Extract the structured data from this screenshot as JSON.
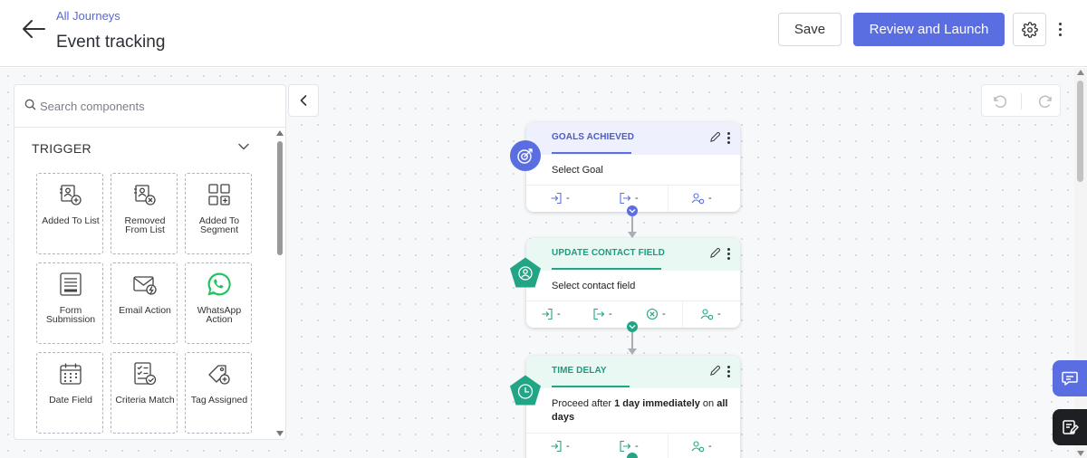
{
  "header": {
    "breadcrumb": "All Journeys",
    "title": "Event tracking",
    "save_label": "Save",
    "launch_label": "Review and Launch"
  },
  "panel": {
    "search_placeholder": "Search components",
    "section_title": "TRIGGER",
    "components": [
      {
        "label": "Added To List",
        "icon": "user-list-add-icon"
      },
      {
        "label": "Removed From List",
        "icon": "user-list-remove-icon"
      },
      {
        "label": "Added To Segment",
        "icon": "segment-add-icon"
      },
      {
        "label": "Form Submission",
        "icon": "form-icon"
      },
      {
        "label": "Email Action",
        "icon": "email-action-icon"
      },
      {
        "label": "WhatsApp Action",
        "icon": "whatsapp-icon"
      },
      {
        "label": "Date Field",
        "icon": "calendar-icon"
      },
      {
        "label": "Criteria Match",
        "icon": "checklist-icon"
      },
      {
        "label": "Tag Assigned",
        "icon": "tag-add-icon"
      }
    ]
  },
  "nodes": [
    {
      "title": "GOALS ACHIEVED",
      "body": "Select Goal",
      "footer": [
        "-",
        "-",
        "-"
      ],
      "color": "#5b6ee1"
    },
    {
      "title": "UPDATE CONTACT FIELD",
      "body": "Select contact field",
      "footer": [
        "-",
        "-",
        "-",
        "-"
      ],
      "color": "#21a584"
    },
    {
      "title": "TIME DELAY",
      "body_parts": [
        "Proceed after ",
        "1 day immediately",
        " on ",
        "all days"
      ],
      "footer": [
        "-",
        "-",
        "-"
      ],
      "color": "#21a584"
    }
  ],
  "colors": {
    "primary": "#5b6ee1",
    "teal": "#21a584",
    "dark": "#1e1f22"
  }
}
